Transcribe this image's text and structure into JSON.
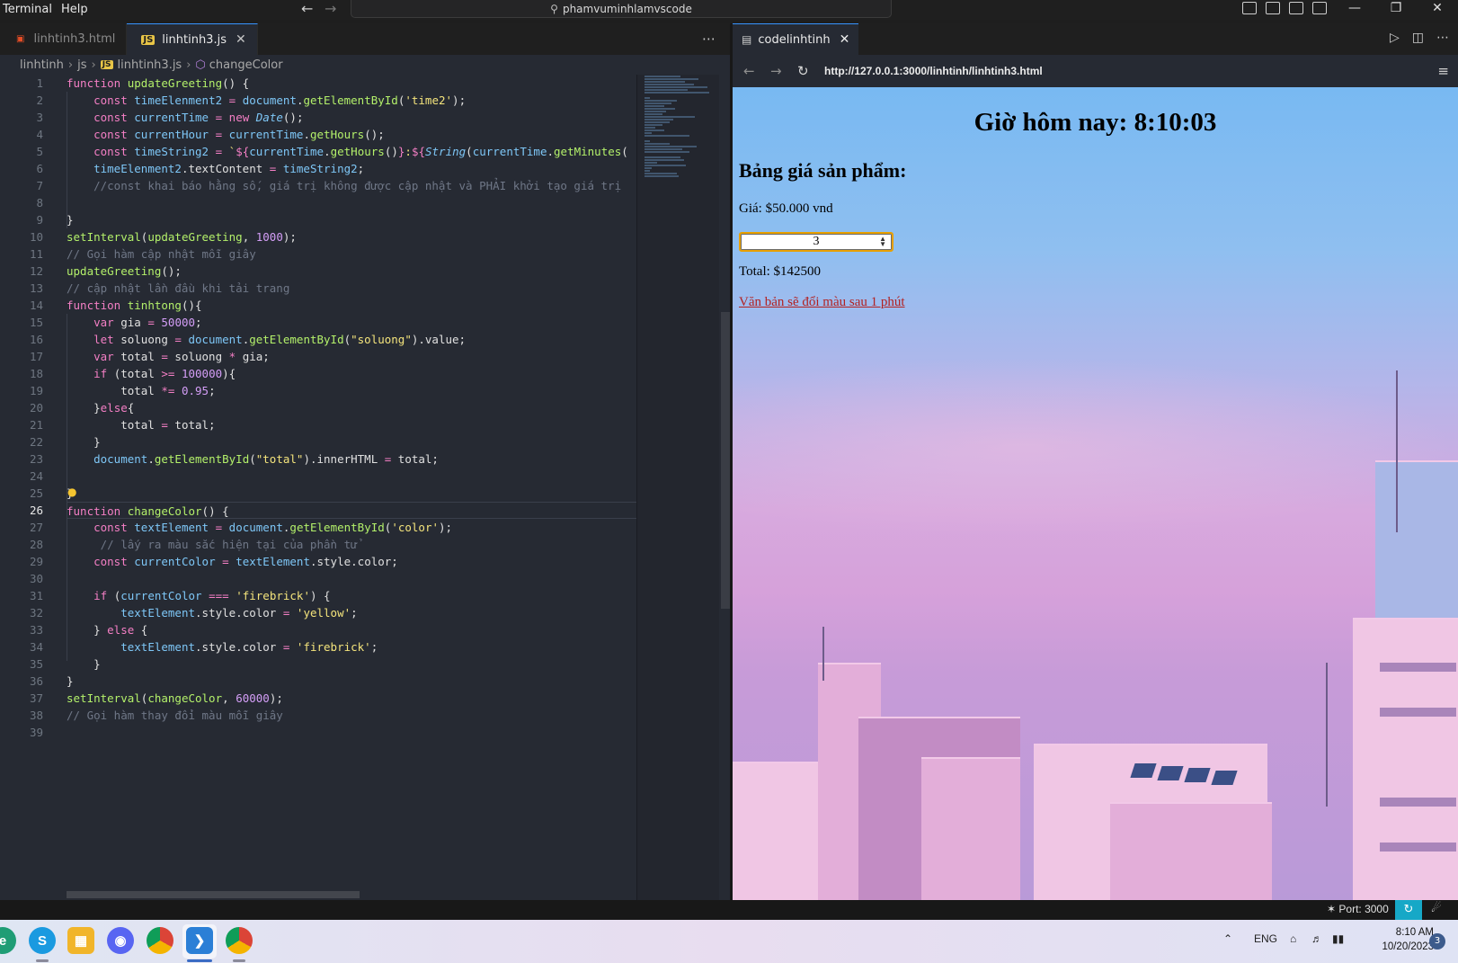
{
  "titlebar": {
    "menu": [
      "Terminal",
      "Help"
    ],
    "command_center": "phamvuminhlamvscode"
  },
  "editor": {
    "tabs": [
      {
        "label": "linhtinh3.html",
        "icon": "html-file-icon",
        "active": false
      },
      {
        "label": "linhtinh3.js",
        "icon": "js-file-icon",
        "active": true
      }
    ],
    "breadcrumb": [
      "linhtinh",
      "js",
      "linhtinh3.js",
      "changeColor"
    ],
    "current_line": 26,
    "line_count": 39
  },
  "browser": {
    "tab_label": "codelinhtinh",
    "url": "http://127.0.0.1:3000/linhtinh/linhtinh3.html",
    "page": {
      "heading": "Giờ hôm nay: 8:10:03",
      "subheading": "Bảng giá sản phẩm:",
      "price": "Giá: $50.000 vnd",
      "quantity": "3",
      "total": "Total: $142500",
      "color_text": "Văn bản sẽ đổi màu sau 1 phút",
      "color_text_color": "#b22222"
    }
  },
  "statusbar": {
    "port": "Port: 3000"
  },
  "taskbar": {
    "apps": [
      "edge-icon",
      "skype-icon",
      "file-explorer-icon",
      "discord-icon",
      "chrome-icon",
      "vscode-icon",
      "chrome-profile-icon"
    ],
    "language": "ENG",
    "time": "8:10 AM",
    "date": "10/20/2023",
    "notification_count": "3"
  },
  "colors": {
    "accent": "#3794ff",
    "editor_bg": "#262a33",
    "status_sync": "#16a8c7"
  }
}
